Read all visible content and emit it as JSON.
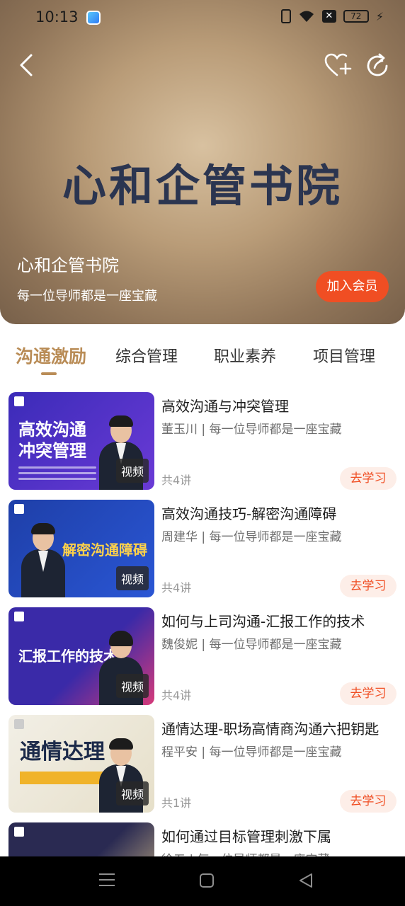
{
  "status_bar": {
    "time": "10:13",
    "battery": "72"
  },
  "hero": {
    "logo_text": "心和企管书院",
    "title": "心和企管书院",
    "subtitle": "每一位导师都是一座宝藏",
    "join_button": "加入会员",
    "icons": {
      "back": "back-chevron-icon",
      "favorite": "heart-plus-icon",
      "share": "share-refresh-icon"
    }
  },
  "tabs": [
    {
      "label": "沟通激励",
      "active": true
    },
    {
      "label": "综合管理",
      "active": false
    },
    {
      "label": "职业素养",
      "active": false
    },
    {
      "label": "项目管理",
      "active": false
    }
  ],
  "courses": [
    {
      "title": "高效沟通与冲突管理",
      "meta": "董玉川 | 每一位导师都是一座宝藏",
      "count": "共4讲",
      "button": "去学习",
      "thumb_tag": "视频",
      "thumb_text": "高效沟通\n冲突管理",
      "thumb_color_a": "#3b2bb8",
      "thumb_color_b": "#6a3ad6"
    },
    {
      "title": "高效沟通技巧-解密沟通障碍",
      "meta": "周建华 | 每一位导师都是一座宝藏",
      "count": "共4讲",
      "button": "去学习",
      "thumb_tag": "视频",
      "thumb_text": "解密沟通障碍",
      "thumb_color_a": "#1e3fa8",
      "thumb_color_b": "#2a56d4"
    },
    {
      "title": "如何与上司沟通-汇报工作的技术",
      "meta": "魏俊妮 | 每一位导师都是一座宝藏",
      "count": "共4讲",
      "button": "去学习",
      "thumb_tag": "视频",
      "thumb_text": "汇报工作的技术",
      "thumb_color_a": "#3a2aa8",
      "thumb_color_b": "#d63a7a"
    },
    {
      "title": "通情达理-职场高情商沟通六把钥匙",
      "meta": "程平安 | 每一位导师都是一座宝藏",
      "count": "共1讲",
      "button": "去学习",
      "thumb_tag": "视频",
      "thumb_text": "通情达理",
      "thumb_color_a": "#f2efe6",
      "thumb_color_b": "#e6dfc9"
    },
    {
      "title": "如何通过目标管理刺激下属",
      "meta": "徐五 | 每一位导师都是一座宝藏",
      "count": "",
      "button": "",
      "thumb_tag": "",
      "thumb_text": "",
      "thumb_color_a": "#2a2a52",
      "thumb_color_b": "#d8c08a"
    }
  ]
}
